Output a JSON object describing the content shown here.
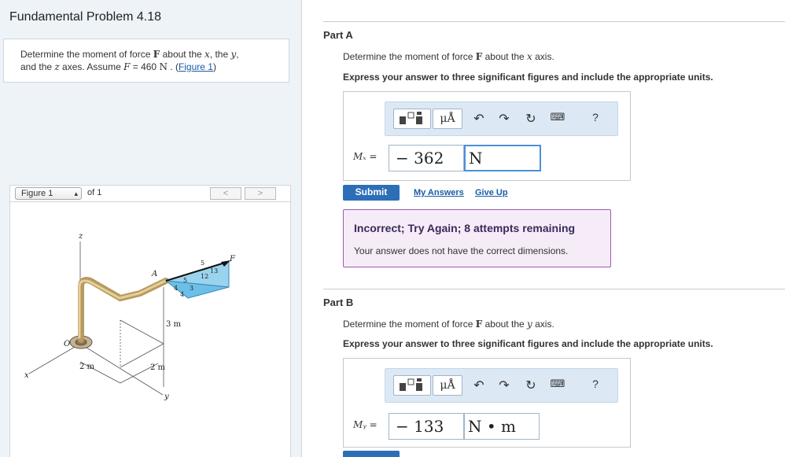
{
  "problem": {
    "title": "Fundamental Problem 4.18",
    "statement_prefix": "Determine the moment of force ",
    "force_symbol": "F",
    "statement_mid1": " about the ",
    "x_var": "x",
    "statement_mid2": ", the ",
    "y_var": "y",
    "statement_mid3": ",",
    "statement_line2_prefix": "and the ",
    "z_var": "z",
    "statement_line2_mid": " axes. Assume ",
    "assume_var": "F",
    "assume_eq": " = 460 ",
    "assume_unit": "N",
    "assume_end": " . (",
    "figure_link": "Figure 1",
    "close_paren": ")"
  },
  "figure_nav": {
    "select_value": "Figure 1",
    "of_text": "of 1",
    "prev": "<",
    "next": ">"
  },
  "figure": {
    "labels": {
      "z": "z",
      "x": "x",
      "y": "y",
      "O": "O",
      "A": "A",
      "F": "F",
      "dim_3m": "3 m",
      "dim_2m_a": "2 m",
      "dim_2m_b": "2 m",
      "n5a": "5",
      "n13": "13",
      "n12": "12",
      "n5b": "5",
      "n4a": "4",
      "n4b": "4",
      "n3": "3"
    }
  },
  "toolbar": {
    "templates_icon": "templates-icon",
    "units_label": "μÅ",
    "undo_icon": "undo-icon",
    "redo_icon": "redo-icon",
    "reset_icon": "reset-icon",
    "keyboard_icon": "keyboard-icon",
    "help_label": "?"
  },
  "partA": {
    "label": "Part A",
    "q_prefix": "Determine the moment of force ",
    "q_force": "F",
    "q_mid": " about the ",
    "q_axis": "x",
    "q_end": " axis.",
    "instruction": "Express your answer to three significant figures and include the appropriate units.",
    "var_label": "Mₓ =",
    "value": "− 362",
    "unit": "N",
    "submit": "Submit",
    "my_answers": "My Answers",
    "give_up": "Give Up",
    "feedback_title": "Incorrect; Try Again; 8 attempts remaining",
    "feedback_msg": "Your answer does not have the correct dimensions."
  },
  "partB": {
    "label": "Part B",
    "q_prefix": "Determine the moment of force ",
    "q_force": "F",
    "q_mid": " about the ",
    "q_axis": "y",
    "q_end": " axis.",
    "instruction": "Express your answer to three significant figures and include the appropriate units.",
    "var_label": "Mᵧ =",
    "value": "− 133",
    "unit": "N • m"
  },
  "colors": {
    "accent": "#2c6fb7",
    "link": "#1a5ba8",
    "feedback_bg": "#f5ecf7",
    "feedback_border": "#a05ab0",
    "toolbar_bg": "#dce9f5"
  }
}
